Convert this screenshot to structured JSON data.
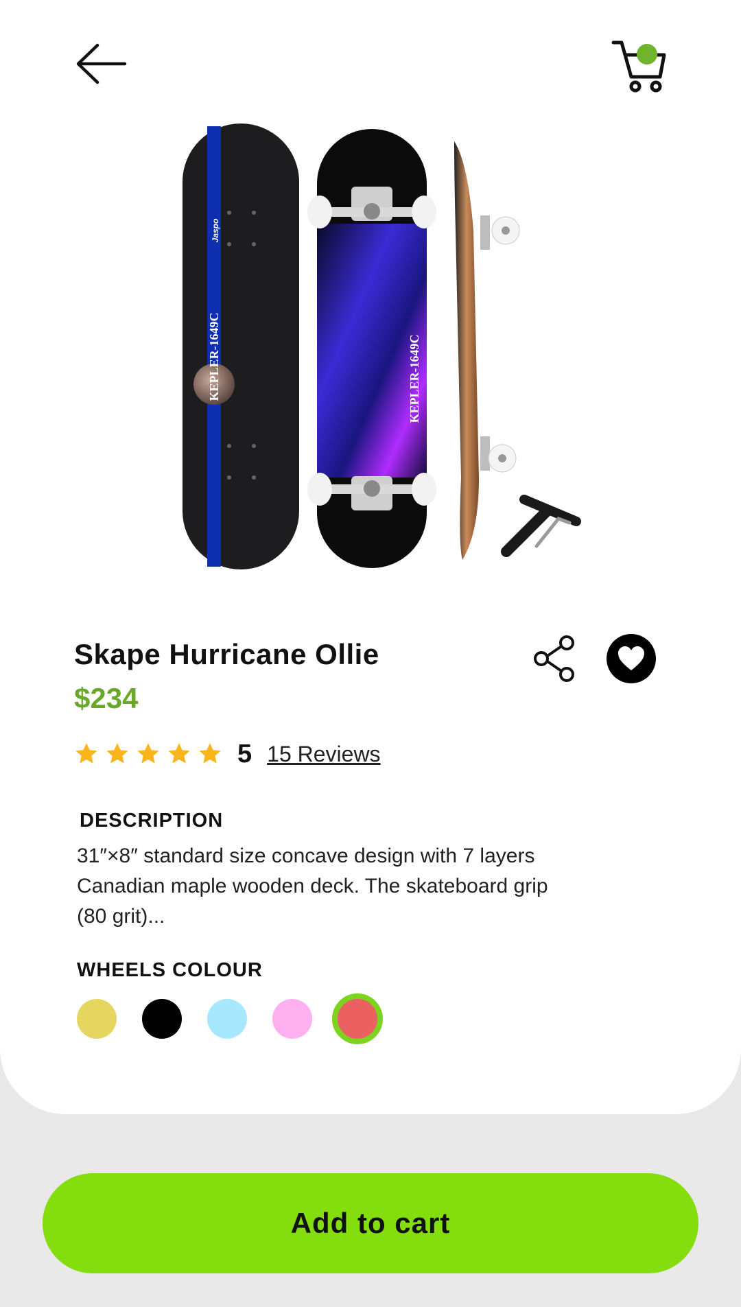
{
  "product": {
    "title": "Skape Hurricane Ollie",
    "price": "$234",
    "rating": {
      "stars": 5,
      "value": "5",
      "reviews_label": "15 Reviews"
    },
    "deck_text": "KEPLER-1649C",
    "brand_mark": "Jaspo"
  },
  "description": {
    "heading": "DESCRIPTION",
    "text": "31″×8″ standard size concave design with 7 layers Canadian maple wooden deck. The skateboard grip (80 grit)..."
  },
  "wheels": {
    "heading": "WHEELS COLOUR",
    "options": [
      {
        "name": "yellow",
        "color": "#e6d660",
        "selected": false
      },
      {
        "name": "black",
        "color": "#000000",
        "selected": false
      },
      {
        "name": "light-blue",
        "color": "#a8e8ff",
        "selected": false
      },
      {
        "name": "pink",
        "color": "#ffb0ee",
        "selected": false
      },
      {
        "name": "red",
        "color": "#eb6161",
        "selected": true
      }
    ]
  },
  "actions": {
    "add_to_cart": "Add to cart"
  },
  "icons": {
    "back": "back-arrow-icon",
    "cart": "cart-icon",
    "share": "share-icon",
    "favorite": "heart-icon",
    "star": "star-icon"
  },
  "colors": {
    "accent": "#84dd0c",
    "price": "#6aa82a",
    "badge": "#6fb42c",
    "star": "#f9b51b"
  }
}
